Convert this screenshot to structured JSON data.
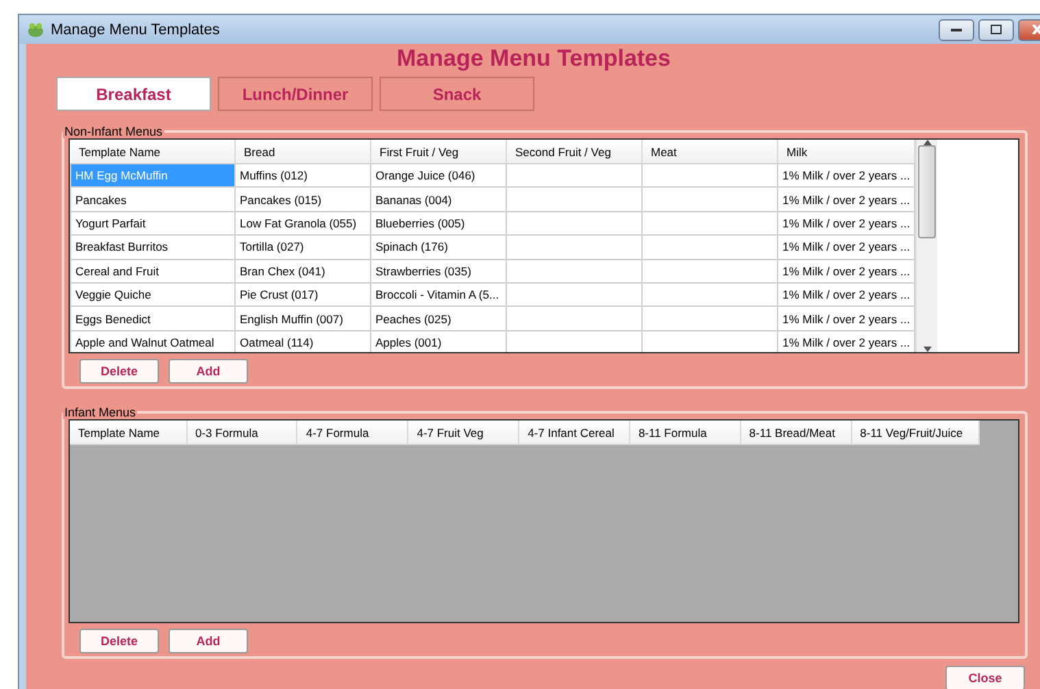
{
  "window": {
    "title": "Manage Menu Templates"
  },
  "heading": "Manage Menu Templates",
  "tabs": [
    {
      "label": "Breakfast",
      "selected": true
    },
    {
      "label": "Lunch/Dinner",
      "selected": false
    },
    {
      "label": "Snack",
      "selected": false
    }
  ],
  "non_infant": {
    "legend": "Non-Infant Menus",
    "columns": [
      "Template Name",
      "Bread",
      "First Fruit / Veg",
      "Second Fruit / Veg",
      "Meat",
      "Milk"
    ],
    "rows": [
      {
        "cells": [
          "HM Egg McMuffin",
          "Muffins (012)",
          "Orange Juice (046)",
          "",
          "",
          "1% Milk / over 2 years ..."
        ],
        "selected": true
      },
      {
        "cells": [
          "Pancakes",
          "Pancakes (015)",
          "Bananas (004)",
          "",
          "",
          "1% Milk / over 2 years ..."
        ],
        "selected": false
      },
      {
        "cells": [
          "Yogurt Parfait",
          "Low Fat Granola (055)",
          "Blueberries (005)",
          "",
          "",
          "1% Milk / over 2 years ..."
        ],
        "selected": false
      },
      {
        "cells": [
          "Breakfast Burritos",
          "Tortilla (027)",
          "Spinach (176)",
          "",
          "",
          "1% Milk / over 2 years ..."
        ],
        "selected": false
      },
      {
        "cells": [
          "Cereal and Fruit",
          "Bran Chex (041)",
          "Strawberries (035)",
          "",
          "",
          "1% Milk / over 2 years ..."
        ],
        "selected": false
      },
      {
        "cells": [
          "Veggie Quiche",
          "Pie Crust (017)",
          "Broccoli - Vitamin A (5...",
          "",
          "",
          "1% Milk / over 2 years ..."
        ],
        "selected": false
      },
      {
        "cells": [
          "Eggs Benedict",
          "English Muffin (007)",
          "Peaches (025)",
          "",
          "",
          "1% Milk / over 2 years ..."
        ],
        "selected": false
      },
      {
        "cells": [
          "Apple and Walnut Oatmeal",
          "Oatmeal (114)",
          "Apples (001)",
          "",
          "",
          "1% Milk / over 2 years ..."
        ],
        "selected": false
      }
    ],
    "buttons": [
      "Delete",
      "Add"
    ]
  },
  "infant": {
    "legend": "Infant Menus",
    "columns": [
      "Template Name",
      "0-3 Formula",
      "4-7 Formula",
      "4-7 Fruit Veg",
      "4-7 Infant Cereal",
      "8-11 Formula",
      "8-11 Bread/Meat",
      "8-11 Veg/Fruit/Juice"
    ],
    "buttons": [
      "Delete",
      "Add"
    ]
  },
  "close_button": "Close"
}
